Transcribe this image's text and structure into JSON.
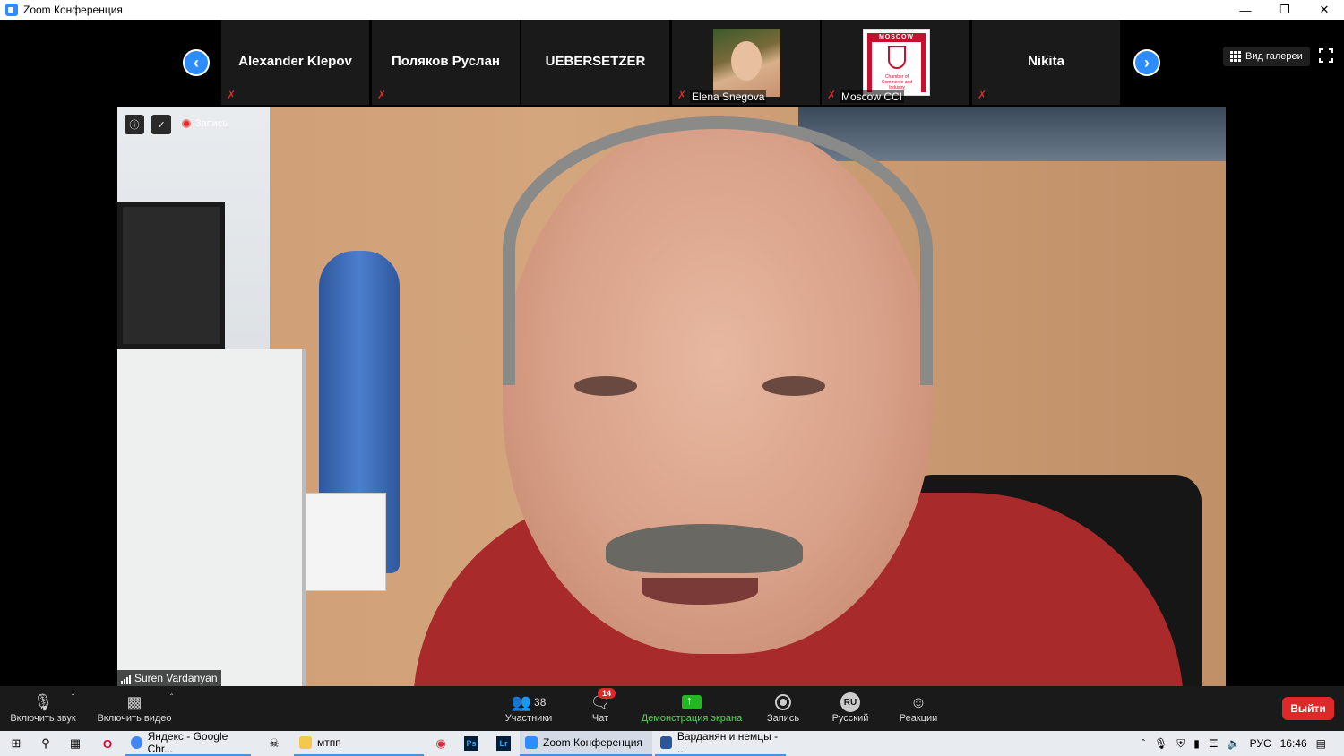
{
  "window": {
    "title": "Zoom Конференция"
  },
  "participants_strip": {
    "tiles": [
      {
        "name": "Alexander Klepov",
        "label": "",
        "has_image": false
      },
      {
        "name": "Поляков Руслан",
        "label": "",
        "has_image": false
      },
      {
        "name": "UEBERSETZER",
        "label": "",
        "has_image": false
      },
      {
        "name": "",
        "label": "Elena Snegova",
        "has_image": true
      },
      {
        "name": "",
        "label": "Moscow CCI",
        "has_image": true
      },
      {
        "name": "Nikita",
        "label": "",
        "has_image": false
      }
    ],
    "logo_band_text": "MOSCOW",
    "logo_sub_text": "Chamber of Commerce and Industry",
    "gallery_view_label": "Вид галереи"
  },
  "main_video": {
    "recording_label": "Запись",
    "speaker_name": "Suren Vardanyan"
  },
  "toolbar": {
    "mute_label": "Включить звук",
    "video_label": "Включить видео",
    "participants_label": "Участники",
    "participants_count": "38",
    "chat_label": "Чат",
    "chat_badge": "14",
    "share_label": "Демонстрация экрана",
    "record_label": "Запись",
    "language_code": "RU",
    "language_label": "Русский",
    "reactions_label": "Реакции",
    "leave_label": "Выйти"
  },
  "taskbar": {
    "items": [
      {
        "label": "Яндекс - Google Chr..."
      },
      {
        "label": "мтпп"
      },
      {
        "label": "Zoom Конференция"
      },
      {
        "label": "Варданян и немцы - ..."
      }
    ],
    "app_icons": {
      "photoshop": "Ps",
      "lightroom": "Lr"
    },
    "language": "РУС",
    "time": "16:46"
  },
  "colors": {
    "zoom_blue": "#2d8cff",
    "leave_red": "#e02828",
    "share_green": "#23b823"
  }
}
